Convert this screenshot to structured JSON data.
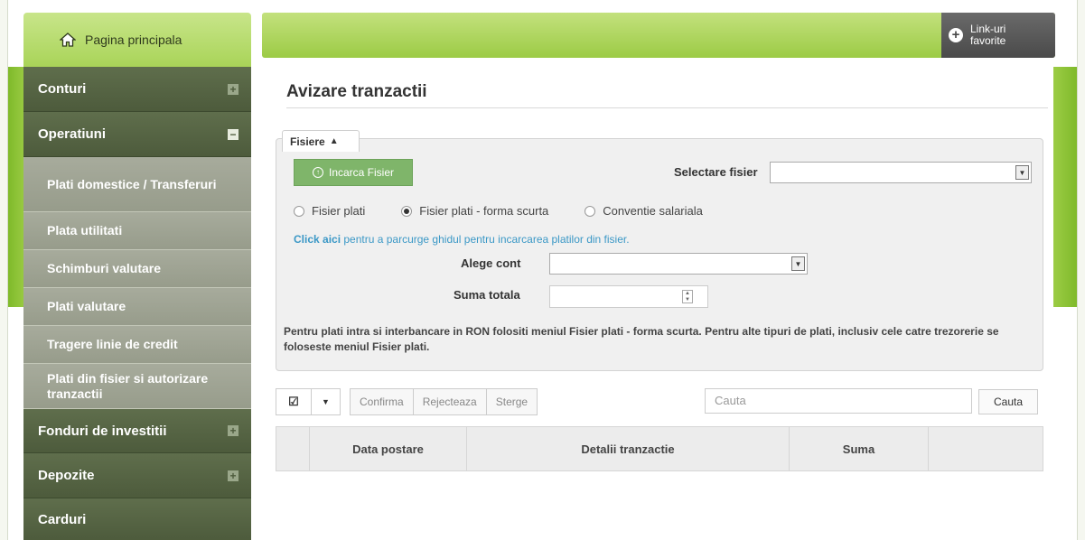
{
  "header": {
    "home_label": "Pagina principala",
    "favorites_line1": "Link-uri",
    "favorites_line2": "favorite"
  },
  "sidebar": {
    "sections": [
      {
        "label": "Conturi",
        "toggle": "+"
      },
      {
        "label": "Operatiuni",
        "toggle": "−"
      }
    ],
    "sub_items": [
      {
        "label": "Plati domestice / Transferuri"
      },
      {
        "label": "Plata utilitati"
      },
      {
        "label": "Schimburi valutare"
      },
      {
        "label": "Plati valutare"
      },
      {
        "label": "Tragere linie de credit"
      },
      {
        "label": "Plati din fisier si autorizare tranzactii"
      }
    ],
    "bottom_sections": [
      {
        "label": "Fonduri de investitii",
        "toggle": "+"
      },
      {
        "label": "Depozite",
        "toggle": "+"
      },
      {
        "label": "Carduri",
        "toggle": ""
      }
    ]
  },
  "main": {
    "title": "Avizare tranzactii",
    "tab_label": "Fisiere",
    "upload_button": "Incarca Fisier",
    "select_file_label": "Selectare fisier",
    "select_file_value": "",
    "radios": [
      {
        "label": "Fisier plati",
        "checked": false
      },
      {
        "label": "Fisier plati - forma scurta",
        "checked": true
      },
      {
        "label": "Conventie salariala",
        "checked": false
      }
    ],
    "guide_link": "Click aici",
    "guide_text": " pentru a parcurge ghidul pentru incarcarea platilor din fisier.",
    "account_label": "Alege cont",
    "account_value": "",
    "total_label": "Suma totala",
    "total_value": "",
    "note": "Pentru plati intra si interbancare in RON folositi meniul Fisier plati - forma scurta. Pentru alte tipuri de plati, inclusiv cele catre trezorerie se foloseste meniul Fisier plati."
  },
  "toolbar": {
    "check_symbol": "☑",
    "caret_symbol": "▼",
    "confirm": "Confirma",
    "reject": "Rejecteaza",
    "delete": "Sterge",
    "search_placeholder": "Cauta",
    "search_button": "Cauta"
  },
  "table": {
    "columns": [
      "",
      "Data postare",
      "Detalii tranzactie",
      "Suma",
      ""
    ]
  },
  "colors": {
    "accent_green": "#9ccb45",
    "sidebar_dark": "#4d5b3c",
    "sidebar_sub": "#979c8b",
    "link_blue": "#3b98c6",
    "upload_green": "#7fb56a"
  }
}
